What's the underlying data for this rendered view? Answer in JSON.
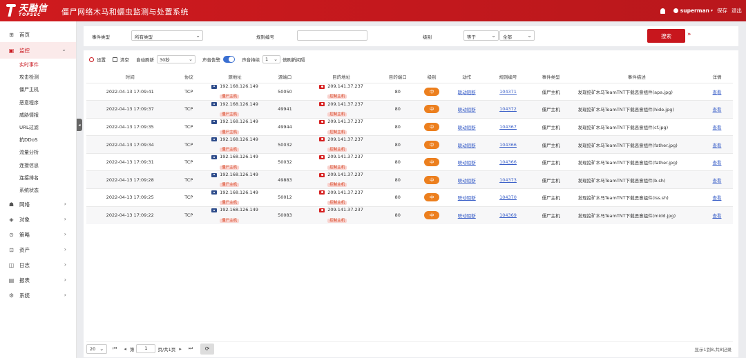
{
  "header": {
    "logo_cn": "天融信",
    "logo_en": "TOPSEC",
    "title": "僵尸网络木马和蠕虫监测与处置系统",
    "user": "superman",
    "save": "保存",
    "logout": "退出"
  },
  "sidebar": {
    "home": "首页",
    "monitor": "监控",
    "monitor_items": [
      "实时事件",
      "攻击检测",
      "僵尸主机",
      "恶意程序",
      "威胁情报",
      "URL过滤",
      "抗DDoS",
      "流量分析",
      "连接信息",
      "连接排名",
      "系统状态"
    ],
    "others": [
      "网络",
      "对象",
      "策略",
      "资产",
      "日志",
      "报表",
      "系统"
    ]
  },
  "filter": {
    "event_type_label": "事件类型",
    "event_type_value": "所有类型",
    "rule_label": "规则编号",
    "rule_value": "",
    "level_label": "级别",
    "level_op": "等于",
    "level_value": "全部",
    "search": "搜索"
  },
  "toolbar": {
    "settings": "设置",
    "clear": "清空",
    "auto_refresh_label": "自动刷新",
    "auto_refresh_value": "30秒",
    "sound_label": "声音告警",
    "sound_dur_label": "声音持续",
    "sound_dur_value": "1",
    "unit": "倍刷新间隔"
  },
  "table": {
    "headers": [
      "时间",
      "协议",
      "源地址",
      "源端口",
      "目的地址",
      "目的端口",
      "级别",
      "动作",
      "规则编号",
      "事件类型",
      "事件描述",
      "详情"
    ],
    "rows": [
      {
        "time": "2022-04-13 17:09:41",
        "proto": "TCP",
        "src": "192.168.126.149",
        "src_tag": "僵尸主机",
        "sport": "50050",
        "dst": "209.141.37.237",
        "dst_tag": "控制主机",
        "dport": "80",
        "level": "中",
        "action": "联动阻断",
        "rule": "104371",
        "type": "僵尸主机",
        "desc": "发现挖矿木马TeamTNT下载恶意组件(apa.jpg)",
        "detail": "查看"
      },
      {
        "time": "2022-04-13 17:09:37",
        "proto": "TCP",
        "src": "192.168.126.149",
        "src_tag": "僵尸主机",
        "sport": "49941",
        "dst": "209.141.37.237",
        "dst_tag": "控制主机",
        "dport": "80",
        "level": "中",
        "action": "联动阻断",
        "rule": "104372",
        "type": "僵尸主机",
        "desc": "发现挖矿木马TeamTNT下载恶意组件(hide.jpg)",
        "detail": "查看"
      },
      {
        "time": "2022-04-13 17:09:35",
        "proto": "TCP",
        "src": "192.168.126.149",
        "src_tag": "僵尸主机",
        "sport": "49944",
        "dst": "209.141.37.237",
        "dst_tag": "控制主机",
        "dport": "80",
        "level": "中",
        "action": "联动阻断",
        "rule": "104367",
        "type": "僵尸主机",
        "desc": "发现挖矿木马TeamTNT下载恶意组件(cf.jpg)",
        "detail": "查看"
      },
      {
        "time": "2022-04-13 17:09:34",
        "proto": "TCP",
        "src": "192.168.126.149",
        "src_tag": "僵尸主机",
        "sport": "50032",
        "dst": "209.141.37.237",
        "dst_tag": "控制主机",
        "dport": "80",
        "level": "中",
        "action": "联动阻断",
        "rule": "104366",
        "type": "僵尸主机",
        "desc": "发现挖矿木马TeamTNT下载恶意组件(father.jpg)",
        "detail": "查看"
      },
      {
        "time": "2022-04-13 17:09:31",
        "proto": "TCP",
        "src": "192.168.126.149",
        "src_tag": "僵尸主机",
        "sport": "50032",
        "dst": "209.141.37.237",
        "dst_tag": "控制主机",
        "dport": "80",
        "level": "中",
        "action": "联动阻断",
        "rule": "104366",
        "type": "僵尸主机",
        "desc": "发现挖矿木马TeamTNT下载恶意组件(father.jpg)",
        "detail": "查看"
      },
      {
        "time": "2022-04-13 17:09:28",
        "proto": "TCP",
        "src": "192.168.126.149",
        "src_tag": "僵尸主机",
        "sport": "49883",
        "dst": "209.141.37.237",
        "dst_tag": "控制主机",
        "dport": "80",
        "level": "中",
        "action": "联动阻断",
        "rule": "104373",
        "type": "僵尸主机",
        "desc": "发现挖矿木马TeamTNT下载恶意组件(b.sh)",
        "detail": "查看"
      },
      {
        "time": "2022-04-13 17:09:25",
        "proto": "TCP",
        "src": "192.168.126.149",
        "src_tag": "僵尸主机",
        "sport": "50012",
        "dst": "209.141.37.237",
        "dst_tag": "控制主机",
        "dport": "80",
        "level": "中",
        "action": "联动阻断",
        "rule": "104370",
        "type": "僵尸主机",
        "desc": "发现挖矿木马TeamTNT下载恶意组件(iss.sh)",
        "detail": "查看"
      },
      {
        "time": "2022-04-13 17:09:22",
        "proto": "TCP",
        "src": "192.168.126.149",
        "src_tag": "僵尸主机",
        "sport": "50083",
        "dst": "209.141.37.237",
        "dst_tag": "控制主机",
        "dport": "80",
        "level": "中",
        "action": "联动阻断",
        "rule": "104369",
        "type": "僵尸主机",
        "desc": "发现挖矿木马TeamTNT下载恶意组件(midd.jpg)",
        "detail": "查看"
      }
    ]
  },
  "pager": {
    "page_size": "20",
    "page_label": "第",
    "page_value": "1",
    "page_total": "页/共1页",
    "summary": "显示1到8,共8记录"
  },
  "colors": {
    "brand": "#c8161d",
    "level_mid": "#ec7f1e",
    "link": "#3a5fc8"
  }
}
